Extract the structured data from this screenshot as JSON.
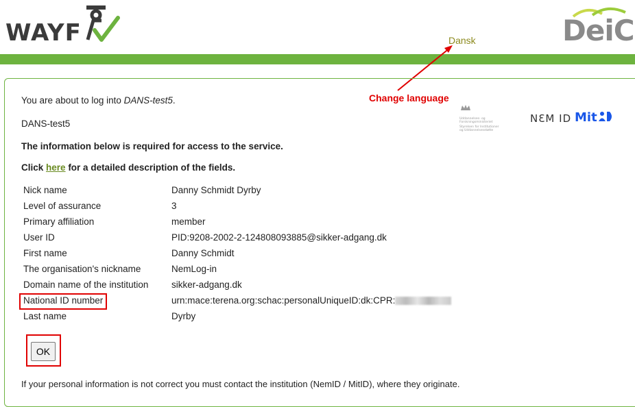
{
  "header": {
    "wayf_logo_text": "WAYF",
    "deic_logo_text": "DeiC",
    "language_link": "Dansk"
  },
  "annotations": {
    "change_language": "Change language"
  },
  "intro": {
    "login_prefix": "You are about to log into ",
    "service_name": "DANS-test5",
    "login_suffix": ".",
    "service_line": "DANS-test5",
    "required_info": "The information below is required for access to the service.",
    "click_prefix": "Click ",
    "click_link": "here",
    "click_suffix": " for a detailed description of the fields."
  },
  "logos": {
    "ministry_line1": "Uddannelses- og",
    "ministry_line2": "Forskningsministeriet",
    "ministry_line3": "Styrelsen for Institutioner",
    "ministry_line4": "og Uddannelsesstøtte",
    "nemid": "NƐM ID",
    "mitid": "Mit",
    "mitid_accent": "#1a57e8"
  },
  "attributes": [
    {
      "name": "Nick name",
      "value": "Danny Schmidt Dyrby"
    },
    {
      "name": "Level of assurance",
      "value": "3"
    },
    {
      "name": "Primary affiliation",
      "value": "member"
    },
    {
      "name": "User ID",
      "value": "PID:9208-2002-2-124808093885@sikker-adgang.dk"
    },
    {
      "name": "First name",
      "value": "Danny Schmidt"
    },
    {
      "name": "The organisation's nickname",
      "value": "NemLog-in"
    },
    {
      "name": "Domain name of the institution",
      "value": "sikker-adgang.dk"
    },
    {
      "name": "National ID number",
      "value": "urn:mace:terena.org:schac:personalUniqueID:dk:CPR:"
    },
    {
      "name": "Last name",
      "value": "Dyrby"
    }
  ],
  "ok_label": "OK",
  "footer": "If your personal information is not correct you must contact the institution (NemID / MitID), where they originate.",
  "colors": {
    "green": "#6db33f",
    "link_olive": "#8c8a1e",
    "annotation_red": "#e00000"
  }
}
